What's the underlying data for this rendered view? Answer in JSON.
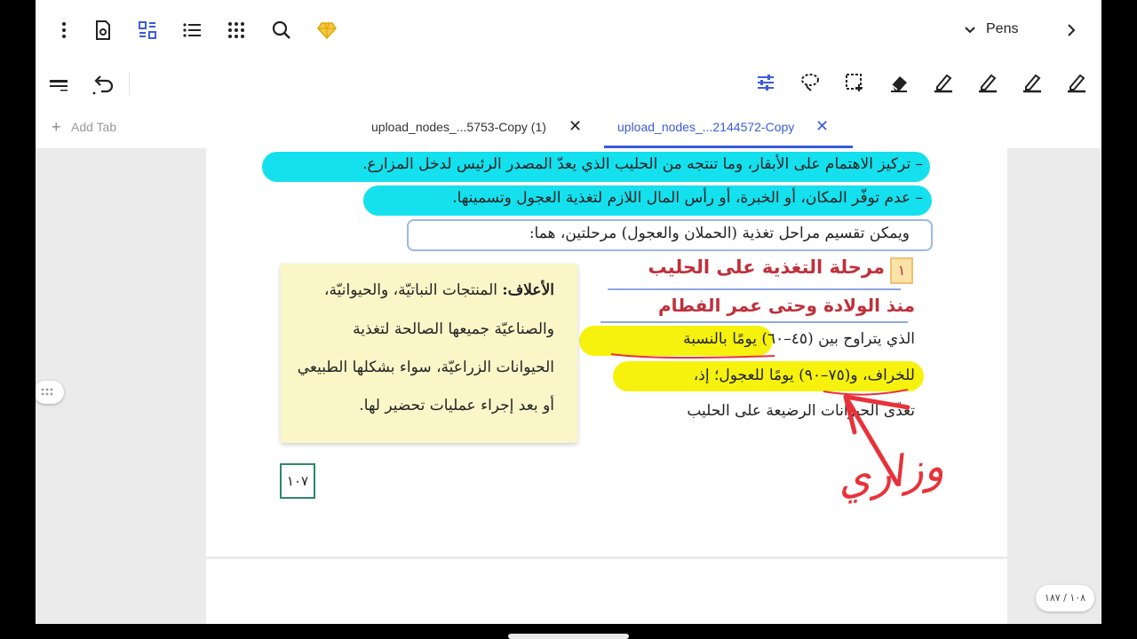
{
  "toolbar": {
    "pen_menu_label": "Pens"
  },
  "tabs": {
    "add_tab_label": "Add Tab",
    "items": [
      {
        "label": "upload_nodes_...5753-Copy (1)"
      },
      {
        "label": "upload_nodes_...2144572-Copy"
      }
    ],
    "accent": "#3b5bdb"
  },
  "document": {
    "line1": "– تركيز الاهتمام على الأبقار، وما تنتجه من الحليب الذي يعدّ المصدر الرئيس لدخل المزارع.",
    "line2": "– عدم توفّر المكان، أو الخبرة، أو رأس المال اللازم لتغذية العجول وتسمينها.",
    "line3": "ويمكن تقسيم مراحل تغذية (الحملان والعجول) مرحلتين، هما:",
    "section_number": "١",
    "heading_line1": "مرحلة التغذية على الحليب",
    "heading_line2": "منذ الولادة وحتى عمر الفطام",
    "para_line1": "الذي يتراوح بين (٤٥–٦٠) يومًا بالنسبة",
    "para_line2": "للخراف، و(٧٥–٩٠) يومًا للعجول؛ إذ،",
    "para_line3": "تغذّى الحيوانات الرضيعة على الحليب",
    "box_term": "الأعلاف:",
    "box_line1": "المنتجات النباتيّة، والحيوانيّة،",
    "box_line2": "والصناعيّة جميعها الصالحة لتغذية",
    "box_line3": "الحيوانات الزراعيّة، سواء بشكلها الطبيعي",
    "box_line4": "أو بعد إجراء عمليات تحضير لها.",
    "page_number": "١٠٧",
    "handwritten_note": "وزاري"
  },
  "page_indicator": "١٠٨ / ١٨٧",
  "colors": {
    "cyan_highlight": "#14e0ee",
    "yellow_highlight": "#f6f20e",
    "heading_red": "#c0303a",
    "ink_red": "#e8323a",
    "box_bg": "#fbf6c8"
  }
}
